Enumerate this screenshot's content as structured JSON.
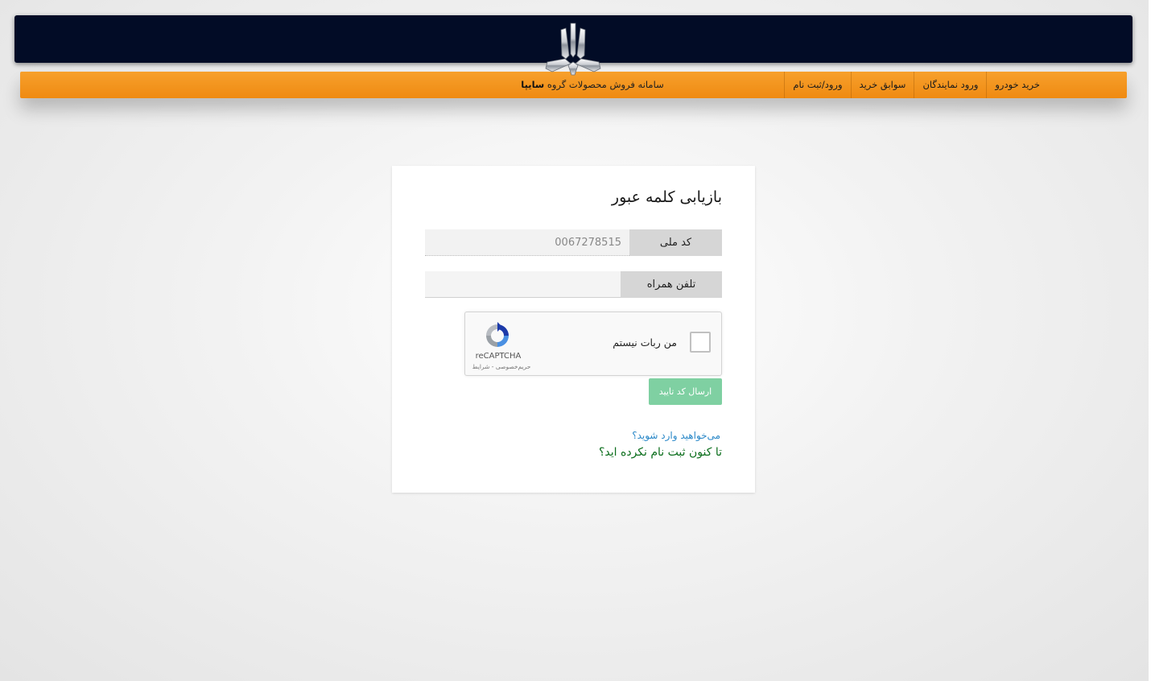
{
  "header": {
    "nav_items": [
      {
        "label": "خرید خودرو"
      },
      {
        "label": "ورود نمایندگان"
      },
      {
        "label": "سوابق خرید"
      },
      {
        "label": "ورود/ثبت نام"
      }
    ],
    "site_title_prefix": "سامانه فروش محصولات گروه",
    "site_title_brand": "سایپا",
    "logo_icon": "saipa-logo-icon",
    "colors": {
      "top_bar": "#020c26",
      "nav_bar": "#f7961f"
    }
  },
  "form": {
    "title": "بازیابی کلمه عبور",
    "national_code": {
      "label": "کد ملی",
      "value": "0067278515"
    },
    "mobile": {
      "label": "تلفن همراه",
      "value": ""
    },
    "captcha": {
      "label": "من ربات نیستم",
      "brand": "reCAPTCHA",
      "terms": "حریم‌خصوصی - شرایط",
      "checked": false
    },
    "submit_label": "ارسال کد تایید",
    "submit_color": "#7fd0a2",
    "login_link": "می‌خواهید وارد شوید؟",
    "register_link": "تا کنون ثبت نام نکرده اید؟"
  }
}
